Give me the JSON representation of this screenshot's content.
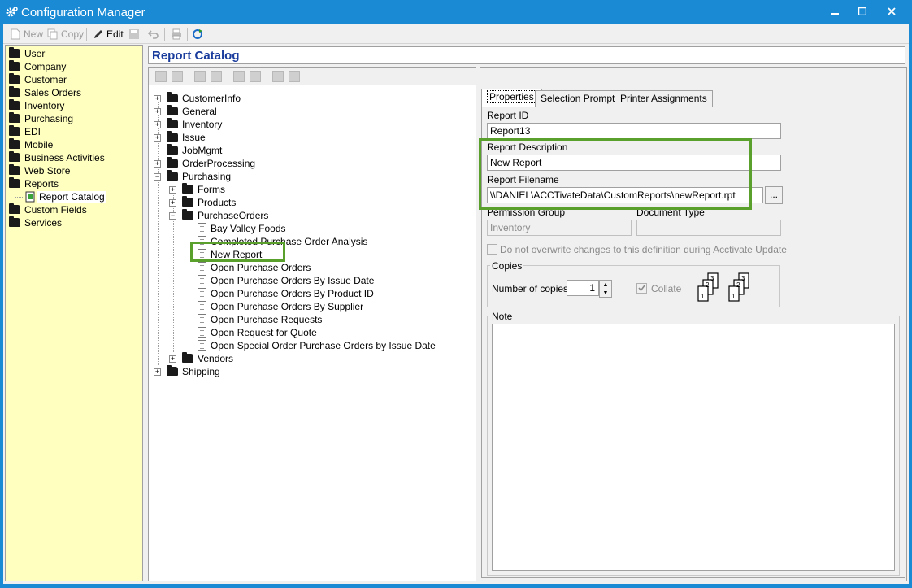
{
  "window": {
    "title": "Configuration Manager"
  },
  "toolbar": {
    "new": "New",
    "copy": "Copy",
    "edit": "Edit"
  },
  "nav": {
    "items": [
      "User",
      "Company",
      "Customer",
      "Sales Orders",
      "Inventory",
      "Purchasing",
      "EDI",
      "Mobile",
      "Business Activities",
      "Web Store",
      "Reports",
      "Report Catalog",
      "Custom Fields",
      "Services"
    ]
  },
  "header": {
    "title": "Report Catalog"
  },
  "tree": {
    "nodes": [
      "CustomerInfo",
      "General",
      "Inventory",
      "Issue",
      "JobMgmt",
      "OrderProcessing",
      "Purchasing",
      "Forms",
      "Products",
      "PurchaseOrders",
      "Bay Valley Foods",
      "Completed Purchase Order Analysis",
      "New Report",
      "Open Purchase Orders",
      "Open Purchase Orders By Issue Date",
      "Open Purchase Orders By Product ID",
      "Open Purchase Orders By Supplier",
      "Open Purchase Requests",
      "Open Request for Quote",
      "Open Special Order Purchase Orders by Issue Date",
      "Vendors",
      "Shipping"
    ]
  },
  "tabs": [
    "Properties",
    "Selection Prompts",
    "Printer Assignments"
  ],
  "properties": {
    "report_id_label": "Report ID",
    "report_id": "Report13",
    "report_description_label": "Report Description",
    "report_description": "New Report",
    "report_filename_label": "Report Filename",
    "report_filename": "\\\\DANIEL\\ACCTivateData\\CustomReports\\newReport.rpt",
    "browse_label": "...",
    "permission_group_label": "Permission Group",
    "permission_group": "Inventory",
    "document_type_label": "Document Type",
    "document_type": "",
    "overwrite_label": "Do not overwrite changes to this definition during Acctivate Update",
    "copies_group_label": "Copies",
    "number_of_copies_label": "Number of copies:",
    "number_of_copies": "1",
    "collate_label": "Collate",
    "note_group_label": "Note"
  },
  "colors": {
    "titlebar": "#1a8ad4",
    "nav_bg": "#ffffc0",
    "header_text": "#1a3c9c",
    "highlight": "#5aa02c"
  }
}
